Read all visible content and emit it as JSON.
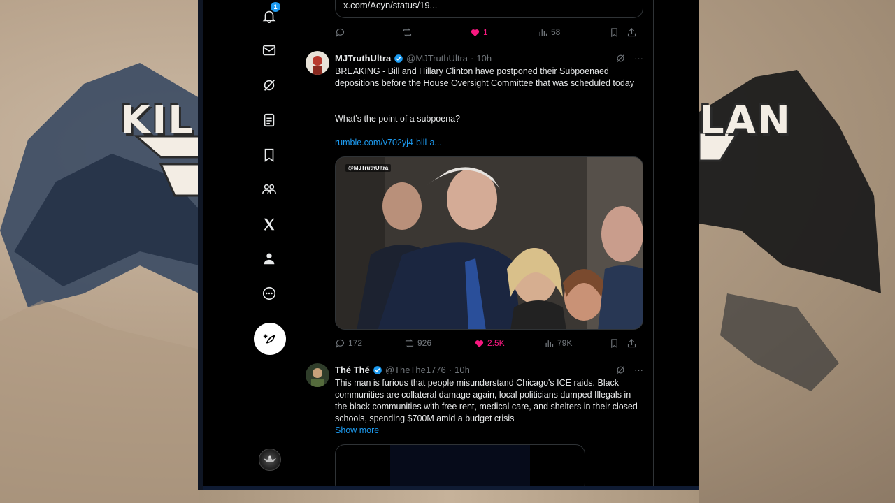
{
  "nav": {
    "notifications_count": "1",
    "items": [
      "notifications",
      "messages",
      "grok",
      "lists",
      "bookmarks",
      "communities",
      "premium",
      "profile",
      "more"
    ]
  },
  "prev_tweet": {
    "link_card_text": "x.com/Acyn/status/19...",
    "likes": "1",
    "views": "58"
  },
  "tweet1": {
    "name": "MJTruthUltra",
    "handle": "@MJTruthUltra",
    "time": "10h",
    "text": "BREAKING - Bill and Hillary Clinton have postponed their Subpoenaed depositions before the House Oversight Committee that was scheduled today",
    "question": "What’s the point of a subpoena?",
    "link": "rumble.com/v702yj4-bill-a...",
    "media_tag": "@MJTruthUltra",
    "replies": "172",
    "reposts": "926",
    "likes": "2.5K",
    "views": "79K"
  },
  "tweet2": {
    "name": "Thé Thé",
    "handle": "@TheThe1776",
    "time": "10h",
    "text": "This man is furious that people misunderstand Chicago's ICE raids.  Black communities are collateral damage again, local politicians dumped Illegals in the black communities with free rent, medical care, and shelters in their closed schools, spending $700M amid a budget crisis",
    "show_more": "Show more"
  },
  "colors": {
    "accent": "#1d9bf0",
    "like": "#f91880",
    "muted": "#71767b",
    "border": "#2f3336"
  },
  "bg_logo_left": "KIL",
  "bg_logo_right": "LAN"
}
